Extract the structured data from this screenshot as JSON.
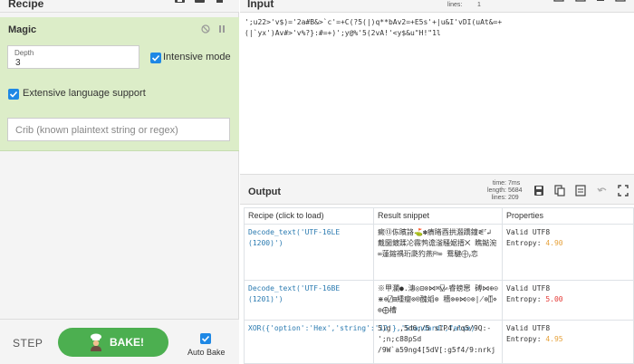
{
  "recipe": {
    "title": "Recipe",
    "icons": [
      "save-icon",
      "folder-icon",
      "trash-icon"
    ]
  },
  "magic": {
    "title": "Magic",
    "depth_label": "Depth",
    "depth_value": "3",
    "intensive_label": "Intensive mode",
    "intensive_checked": true,
    "extensive_label": "Extensive language support",
    "extensive_checked": true,
    "crib_placeholder": "Crib (known plaintext string or regex)"
  },
  "controls": {
    "step_label": "STEP",
    "bake_label": "BAKE!",
    "autobake_label": "Auto Bake",
    "autobake_checked": true
  },
  "input": {
    "title": "Input",
    "lines_label": "lines:",
    "lines_value": "1",
    "text_line1": "';u22>'v$)='2a#B&>`c'=+C(?5(|)q**bAv2=+E5s'+|u&I'vDI(uAt&=+",
    "text_line2": "(|`yx')Av#>'v%?}:#=+)';y@%'5(2vA!'<y$&u\"H!\"1l"
  },
  "output": {
    "title": "Output",
    "time_label": "time:",
    "time_value": "7ms",
    "length_label": "length:",
    "length_value": "5684",
    "lines_label": "lines:",
    "lines_value": "209",
    "columns": [
      "Recipe (click to load)",
      "Result snippet",
      "Properties"
    ],
    "rows": [
      {
        "recipe": "Decode_text('UTF-16LE (1200)')",
        "snippet": "癜⑬㑈矉詻⛳✽㿎睹⾣拱溵蹻鐘⪛ᣗ↲ 戴圞鍍蹂㓆霺鹁谵滏騷婮搢⨉ 瞧鐑涴∞蓮鏥禑珩瓞犳燕⛿∞ 鴌騝⨁⹜恋",
        "valid": "Valid UTF8",
        "entropy_label": "Entropy:",
        "entropy_value": "4.90",
        "entropy_color": "#e6a23c"
      },
      {
        "recipe": "Decode_text('UTF-16BE (1201)')",
        "snippet": "※甲瀾●.潓◎⊡⊗⋈⌘⍌✍睿螃窸 磗⋈⊕⊙⋇⊕⍁⊞緟瘿⊗⍟醜嫍⊗ 穯⊗⊕⋈⊝⊗∤⊗⍐⋄⊗⨁槽",
        "valid": "Valid UTF8",
        "entropy_label": "Entropy:",
        "entropy_value": "5.00",
        "entropy_color": "#e53935"
      },
      {
        "recipe": "XOR({'option':'Hex','string':'12'},'Standard',false)",
        "snippet": "5)g  ,5d6;/5 s1P4,rq5/9Q:-';n;c88pSd\n/9W`a59ng4[5dV[:g5f4/9:nrkj",
        "valid": "Valid UTF8",
        "entropy_label": "Entropy:",
        "entropy_value": "4.95",
        "entropy_color": "#e6a23c"
      }
    ]
  }
}
